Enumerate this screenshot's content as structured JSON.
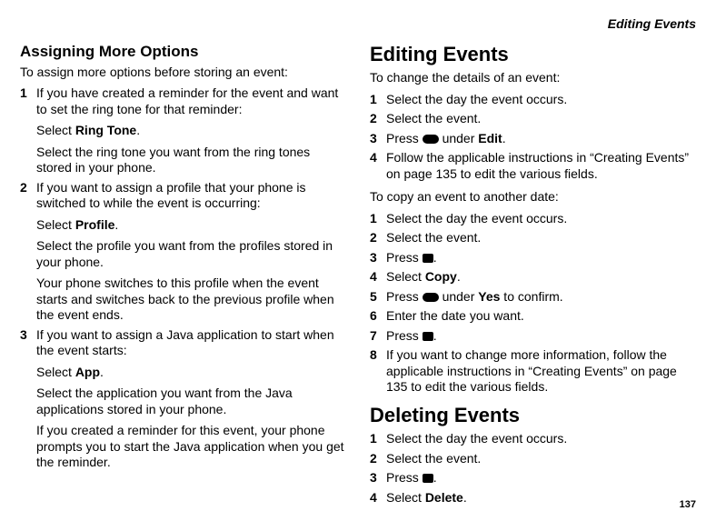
{
  "running_head": "Editing Events",
  "page_number": "137",
  "icons": {
    "rounded_key": "rounded-key-icon",
    "square_key": "square-key-icon"
  },
  "left": {
    "heading": "Assigning More Options",
    "intro": "To assign more options before storing an event:",
    "steps": [
      {
        "n": "1",
        "paras": [
          "If you have created a reminder for the event and want to set the ring tone for that reminder:",
          "Select <b>Ring Tone</b>.",
          "Select the ring tone you want from the ring tones stored in your phone."
        ]
      },
      {
        "n": "2",
        "paras": [
          "If you want to assign a profile that your phone is switched to while the event is occurring:",
          "Select <b>Profile</b>.",
          "Select the profile you want from the profiles stored in your phone.",
          "Your phone switches to this profile when the event starts and switches back to the previous profile when the event ends."
        ]
      },
      {
        "n": "3",
        "paras": [
          "If you want to assign a Java application to start when the event starts:",
          "Select <b>App</b>.",
          "Select the application you want from the Java applications stored in your phone.",
          "If you created a reminder for this event, your phone prompts you to start the Java application when you get the reminder."
        ]
      }
    ]
  },
  "right": {
    "editing": {
      "heading": "Editing Events",
      "intro1": "To change the details of an event:",
      "steps1": [
        {
          "n": "1",
          "html": "Select the day the event occurs."
        },
        {
          "n": "2",
          "html": "Select the event."
        },
        {
          "n": "3",
          "icon": "rounded_key",
          "prefix": "Press ",
          "suffix": " under <b>Edit</b>."
        },
        {
          "n": "4",
          "html": "Follow the applicable instructions in “Creating Events” on page 135 to edit the various fields."
        }
      ],
      "intro2": "To copy an event to another date:",
      "steps2": [
        {
          "n": "1",
          "html": "Select the day the event occurs."
        },
        {
          "n": "2",
          "html": "Select the event."
        },
        {
          "n": "3",
          "icon": "square_key",
          "prefix": "Press ",
          "suffix": "."
        },
        {
          "n": "4",
          "html": "Select <b>Copy</b>."
        },
        {
          "n": "5",
          "icon": "rounded_key",
          "prefix": "Press ",
          "suffix": " under <b>Yes</b> to confirm."
        },
        {
          "n": "6",
          "html": "Enter the date you want."
        },
        {
          "n": "7",
          "icon": "square_key",
          "prefix": "Press ",
          "suffix": "."
        },
        {
          "n": "8",
          "html": "If you want to change more information, follow the applicable instructions in “Creating Events” on page 135 to edit the various fields."
        }
      ]
    },
    "deleting": {
      "heading": "Deleting Events",
      "steps": [
        {
          "n": "1",
          "html": "Select the day the event occurs."
        },
        {
          "n": "2",
          "html": "Select the event."
        },
        {
          "n": "3",
          "icon": "square_key",
          "prefix": "Press ",
          "suffix": "."
        },
        {
          "n": "4",
          "html": "Select <b>Delete</b>."
        }
      ]
    }
  }
}
